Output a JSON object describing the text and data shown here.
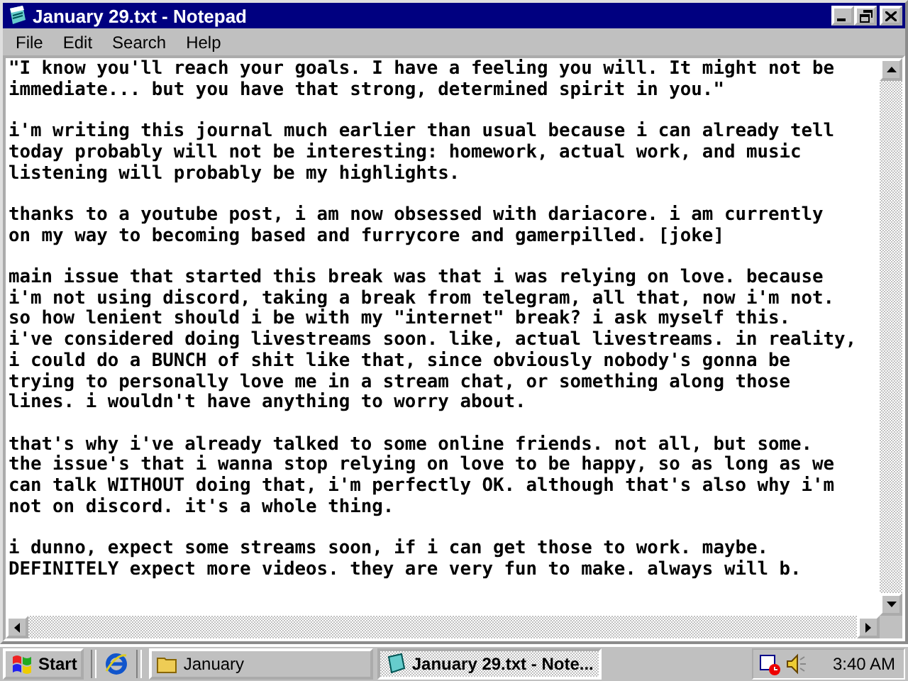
{
  "window": {
    "title": "January 29.txt - Notepad"
  },
  "menu": [
    "File",
    "Edit",
    "Search",
    "Help"
  ],
  "document": {
    "paragraphs": [
      [
        "\"I know you'll reach your goals. I have a feeling you will. It might not be",
        "immediate... but you have that strong, determined spirit in you.\""
      ],
      [
        "i'm writing this journal much earlier than usual because i can already tell",
        "today probably will not be interesting: homework, actual work, and music",
        "listening will probably be my highlights."
      ],
      [
        "thanks to a youtube post, i am now obsessed with dariacore. i am currently",
        "on my way to becoming based and furrycore and gamerpilled. [joke]"
      ],
      [
        "main issue that started this break was that i was relying on love. because",
        "i'm not using discord, taking a break from telegram, all that, now i'm not.",
        "so how lenient should i be with my \"internet\" break? i ask myself this.",
        "i've considered doing livestreams soon. like, actual livestreams. in reality,",
        "i could do a BUNCH of shit like that, since obviously nobody's gonna be",
        "trying to personally love me in a stream chat, or something along those",
        "lines. i wouldn't have anything to worry about."
      ],
      [
        "that's why i've already talked to some online friends. not all, but some.",
        "the issue's that i wanna stop relying on love to be happy, so as long as we",
        "can talk WITHOUT doing that, i'm perfectly OK. although that's also why i'm",
        "not on discord. it's a whole thing."
      ],
      [
        "i dunno, expect some streams soon, if i can get those to work. maybe.",
        "DEFINITELY expect more videos. they are very fun to make. always will b."
      ]
    ]
  },
  "taskbar": {
    "start": "Start",
    "tasks": [
      {
        "label": "January",
        "kind": "folder",
        "selected": false
      },
      {
        "label": "January 29.txt - Note...",
        "kind": "notepad",
        "selected": true
      }
    ],
    "clock": "3:40 AM"
  }
}
